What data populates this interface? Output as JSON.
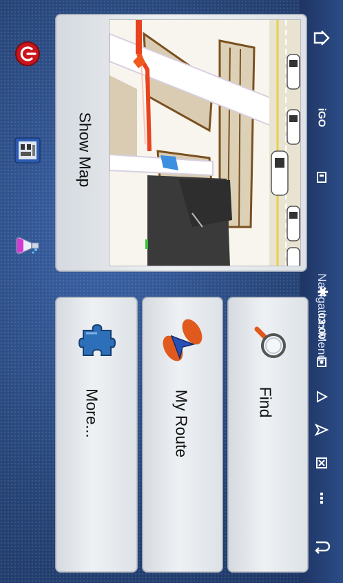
{
  "status_bar": {
    "app_name": "iGO",
    "time": "03:00",
    "title": "Navigation Menu",
    "icons": [
      "home-icon",
      "sd-card-icon",
      "bluetooth-icon",
      "camera-icon",
      "warning-icon",
      "navigate-icon",
      "close-box-icon",
      "more-dots-icon",
      "back-icon"
    ]
  },
  "left_icons": [
    "power-icon",
    "car-dashboard-icon",
    "lab-flask-icon"
  ],
  "tiles": {
    "show_map": "Show Map",
    "find": "Find",
    "my_route": "My Route",
    "more": "More..."
  },
  "colors": {
    "background": "#2a4a82",
    "tile": "#e8ecf0",
    "route": "#e8431e",
    "map_building": "#3a3a3a",
    "map_block": "#d9ccb2"
  }
}
